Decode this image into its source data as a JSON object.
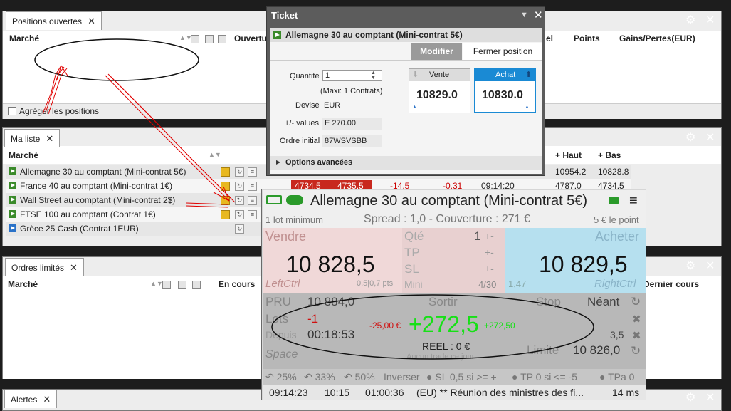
{
  "positions": {
    "tab": "Positions ouvertes",
    "col_market": "Marché",
    "col_ouvert": "Ouvertur",
    "col_level": "el",
    "col_points": "Points",
    "col_pl": "Gains/Pertes(EUR)",
    "aggregate": "Agréger les positions"
  },
  "watchlist": {
    "tab": "Ma liste",
    "col_market": "Marché",
    "col_high": "+ Haut",
    "col_low": "+ Bas",
    "rows": [
      {
        "name": "Allemagne 30 au comptant (Mini-contrat 5€)",
        "high": "10954.2",
        "low": "10828.8"
      },
      {
        "name": "France 40 au comptant (Mini-contrat 1€)",
        "sell": "4734.5",
        "buy": "4735.5",
        "chg": "-14.5",
        "chgpct": "-0.31",
        "time": "09:14:20",
        "high": "4787.0",
        "low": "4734.5"
      },
      {
        "name": "Wall Street au comptant (Mini-contrat 2$)"
      },
      {
        "name": "FTSE 100 au comptant (Contrat 1€)"
      },
      {
        "name": "Grèce 25 Cash (Contrat 1EUR)"
      }
    ]
  },
  "orders": {
    "tab": "Ordres limités",
    "col_market": "Marché",
    "col_status": "En cours",
    "col_last": "Dernier cours"
  },
  "alerts": {
    "tab": "Alertes"
  },
  "ticket": {
    "title": "Ticket",
    "instrument": "Allemagne 30 au comptant (Mini-contrat 5€)",
    "btn_modify": "Modifier",
    "btn_close": "Fermer position",
    "qty_label": "Quantité",
    "qty_value": "1",
    "max_note": "(Maxi: 1 Contrats)",
    "currency_label": "Devise",
    "currency_value": "EUR",
    "pl_label": "+/- values",
    "pl_value": "E 270.00",
    "order_label": "Ordre initial",
    "order_value": "87WSVSBB",
    "sell_label": "Vente",
    "sell_price": "10829.0",
    "buy_label": "Achat",
    "buy_price": "10830.0",
    "advanced": "Options avancées"
  },
  "trade": {
    "title": "Allemagne 30 au comptant (Mini-contrat 5€)",
    "min_lot": "1 lot minimum",
    "spread": "Spread : 1,0 - Couverture : 271 €",
    "per_point": "5 € le point",
    "sell_label": "Vendre",
    "sell_price": "10 828,5",
    "sell_key": "LeftCtrl",
    "sell_spread": "0,5|0,7 pts",
    "qty_label": "Qté",
    "qty_value": "1",
    "tp_label": "TP",
    "sl_label": "SL",
    "mini_label": "Mini",
    "mini_value": "4/30",
    "buy_label": "Acheter",
    "buy_price": "10 829,5",
    "buy_spread": "1,47",
    "buy_key": "RightCtrl",
    "pru_label": "PRU",
    "pru_value": "10 884,0",
    "exit_label": "Sortir",
    "stop_label": "Stop",
    "stop_value": "Néant",
    "lots_label": "Lots",
    "lots_value": "-1",
    "since_label": "Depuis",
    "since_value": "00:18:53",
    "space_label": "Space",
    "neg_eur": "-25,00 €",
    "pl_big": "+272,5",
    "pl_small": "+272,50",
    "reel": "REEL : 0 €",
    "no_trade": "Aucun trade ce jour",
    "limit_label": "Limite",
    "limit_value": "10 826,0",
    "side_value": "3,5",
    "b25": "25%",
    "b33": "33%",
    "b50": "50%",
    "inverse": "Inverser",
    "sl_rule": "SL 0,5 si >= +",
    "tp_rule": "TP 0 si <= -5",
    "tpa": "TPa 0",
    "time1": "09:14:23",
    "time2": "10:15",
    "time3": "01:00:36",
    "news": "(EU) ** Réunion des ministres des fi...",
    "latency": "14 ms"
  }
}
